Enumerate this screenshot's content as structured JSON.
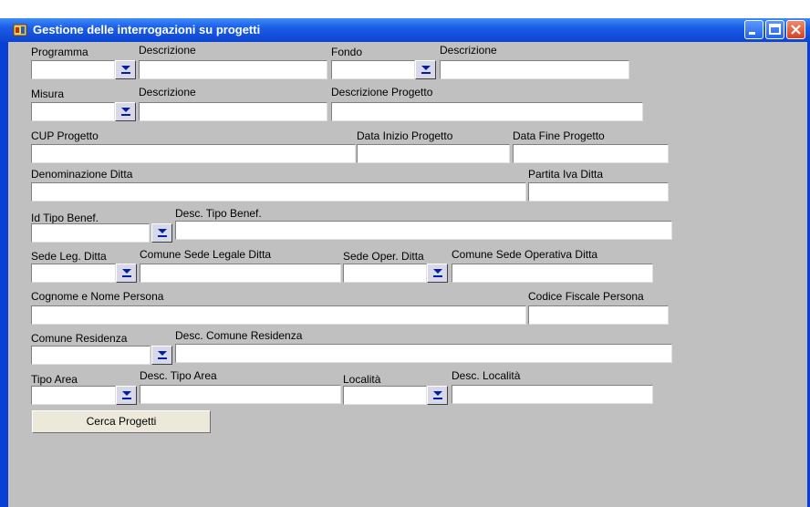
{
  "window": {
    "title": "Gestione delle interrogazioni su progetti",
    "colors": {
      "titlebar": "#0c44d0",
      "background": "#c0c0c0",
      "close": "#d9411e"
    }
  },
  "labels": {
    "programma": "Programma",
    "descrizione_programma": "Descrizione",
    "fondo": "Fondo",
    "descrizione_fondo": "Descrizione",
    "misura": "Misura",
    "descrizione_misura": "Descrizione",
    "descrizione_progetto": "Descrizione Progetto",
    "cup_progetto": "CUP Progetto",
    "data_inizio": "Data Inizio Progetto",
    "data_fine": "Data Fine Progetto",
    "denominazione_ditta": "Denominazione Ditta",
    "partita_iva": "Partita Iva Ditta",
    "id_tipo_benef": "Id Tipo Benef.",
    "desc_tipo_benef": "Desc. Tipo Benef.",
    "sede_leg": "Sede Leg. Ditta",
    "comune_sede_legale": "Comune Sede Legale Ditta",
    "sede_oper": "Sede Oper. Ditta",
    "comune_sede_operativa": "Comune Sede Operativa Ditta",
    "cognome_nome": "Cognome e Nome Persona",
    "codice_fiscale": "Codice Fiscale Persona",
    "comune_residenza": "Comune Residenza",
    "desc_comune_residenza": "Desc. Comune Residenza",
    "tipo_area": "Tipo Area",
    "desc_tipo_area": "Desc. Tipo Area",
    "localita": "Località",
    "desc_localita": "Desc. Località"
  },
  "buttons": {
    "cerca": "Cerca Progetti"
  },
  "icons": {
    "dropdown": "lov-arrow-icon",
    "app": "forms-app-icon"
  }
}
